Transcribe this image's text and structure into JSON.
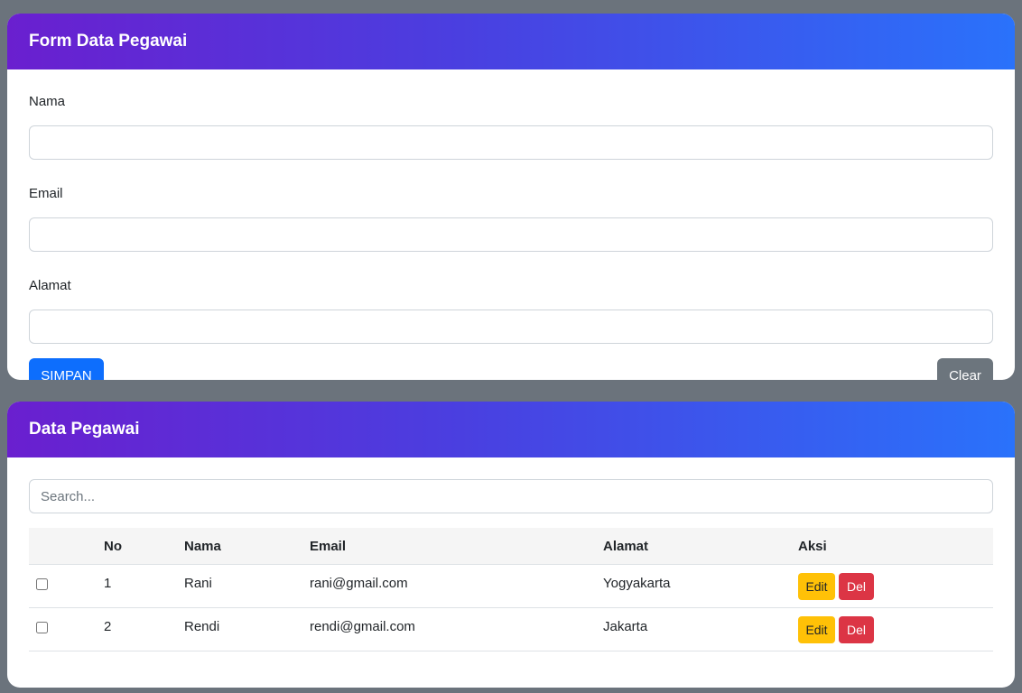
{
  "form": {
    "title": "Form Data Pegawai",
    "fields": [
      {
        "label": "Nama",
        "value": "",
        "placeholder": ""
      },
      {
        "label": "Email",
        "value": "",
        "placeholder": ""
      },
      {
        "label": "Alamat",
        "value": "",
        "placeholder": ""
      }
    ],
    "save_label": "SIMPAN",
    "clear_label": "Clear"
  },
  "list": {
    "title": "Data Pegawai",
    "search": {
      "placeholder": "Search...",
      "value": ""
    },
    "columns": [
      "",
      "No",
      "Nama",
      "Email",
      "Alamat",
      "Aksi"
    ],
    "rows": [
      {
        "checked": false,
        "no": "1",
        "nama": "Rani",
        "email": "rani@gmail.com",
        "alamat": "Yogyakarta",
        "edit_label": "Edit",
        "del_label": "Del"
      },
      {
        "checked": false,
        "no": "2",
        "nama": "Rendi",
        "email": "rendi@gmail.com",
        "alamat": "Jakarta",
        "edit_label": "Edit",
        "del_label": "Del"
      }
    ]
  },
  "colors": {
    "header_gradient_start": "#6a1fcf",
    "header_gradient_end": "#2a72fb",
    "primary": "#0d6efd",
    "secondary": "#6c757d",
    "warning": "#ffc107",
    "danger": "#dc3545",
    "page_background": "#6b737c"
  }
}
